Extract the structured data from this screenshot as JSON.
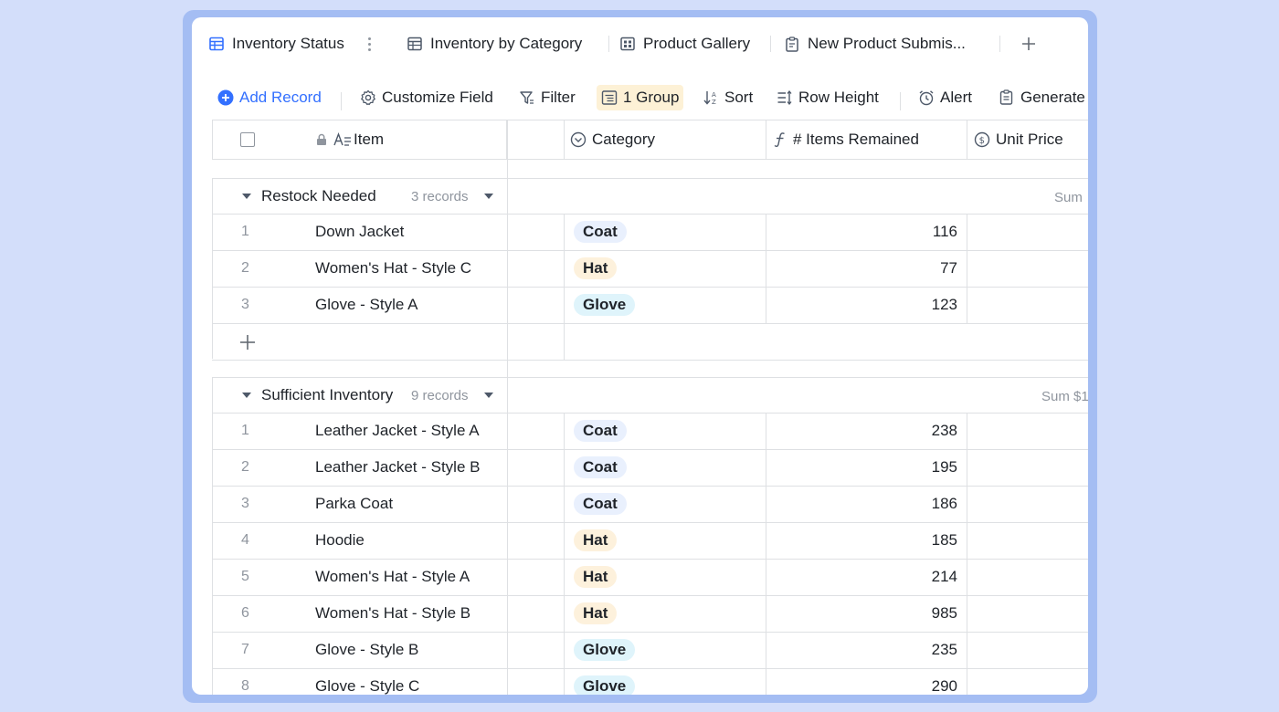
{
  "colors": {
    "accent": "#3370ff",
    "coat_tag": "#e9f0fd",
    "hat_tag": "#fdf1dc",
    "glove_tag": "#dff4fb",
    "group_highlight": "#fdf1d6"
  },
  "tabs": [
    {
      "label": "Inventory Status",
      "icon": "grid-table-icon",
      "active": true
    },
    {
      "label": "Inventory by Category",
      "icon": "table-icon"
    },
    {
      "label": "Product Gallery",
      "icon": "gallery-icon"
    },
    {
      "label": "New Product Submis...",
      "icon": "form-icon"
    }
  ],
  "toolbar": {
    "add_record": "Add Record",
    "customize_field": "Customize Field",
    "filter": "Filter",
    "group": "1 Group",
    "sort": "Sort",
    "row_height": "Row Height",
    "alert": "Alert",
    "generate": "Generate"
  },
  "columns": {
    "item": "Item",
    "category": "Category",
    "items_remained": "# Items Remained",
    "unit_price": "Unit Price"
  },
  "groups": [
    {
      "title": "Restock Needed",
      "count": "3 records",
      "sum": "Sum",
      "rows": [
        {
          "num": "1",
          "item": "Down Jacket",
          "category": "Coat",
          "qty": "116"
        },
        {
          "num": "2",
          "item": "Women's Hat - Style C",
          "category": "Hat",
          "qty": "77"
        },
        {
          "num": "3",
          "item": "Glove - Style A",
          "category": "Glove",
          "qty": "123"
        }
      ]
    },
    {
      "title": "Sufficient Inventory",
      "count": "9 records",
      "sum": "Sum $1",
      "rows": [
        {
          "num": "1",
          "item": "Leather Jacket - Style A",
          "category": "Coat",
          "qty": "238"
        },
        {
          "num": "2",
          "item": "Leather Jacket - Style B",
          "category": "Coat",
          "qty": "195"
        },
        {
          "num": "3",
          "item": "Parka Coat",
          "category": "Coat",
          "qty": "186"
        },
        {
          "num": "4",
          "item": "Hoodie",
          "category": "Hat",
          "qty": "185"
        },
        {
          "num": "5",
          "item": "Women's Hat - Style A",
          "category": "Hat",
          "qty": "214"
        },
        {
          "num": "6",
          "item": "Women's Hat - Style B",
          "category": "Hat",
          "qty": "985"
        },
        {
          "num": "7",
          "item": "Glove - Style B",
          "category": "Glove",
          "qty": "235"
        },
        {
          "num": "8",
          "item": "Glove - Style C",
          "category": "Glove",
          "qty": "290"
        }
      ]
    }
  ]
}
